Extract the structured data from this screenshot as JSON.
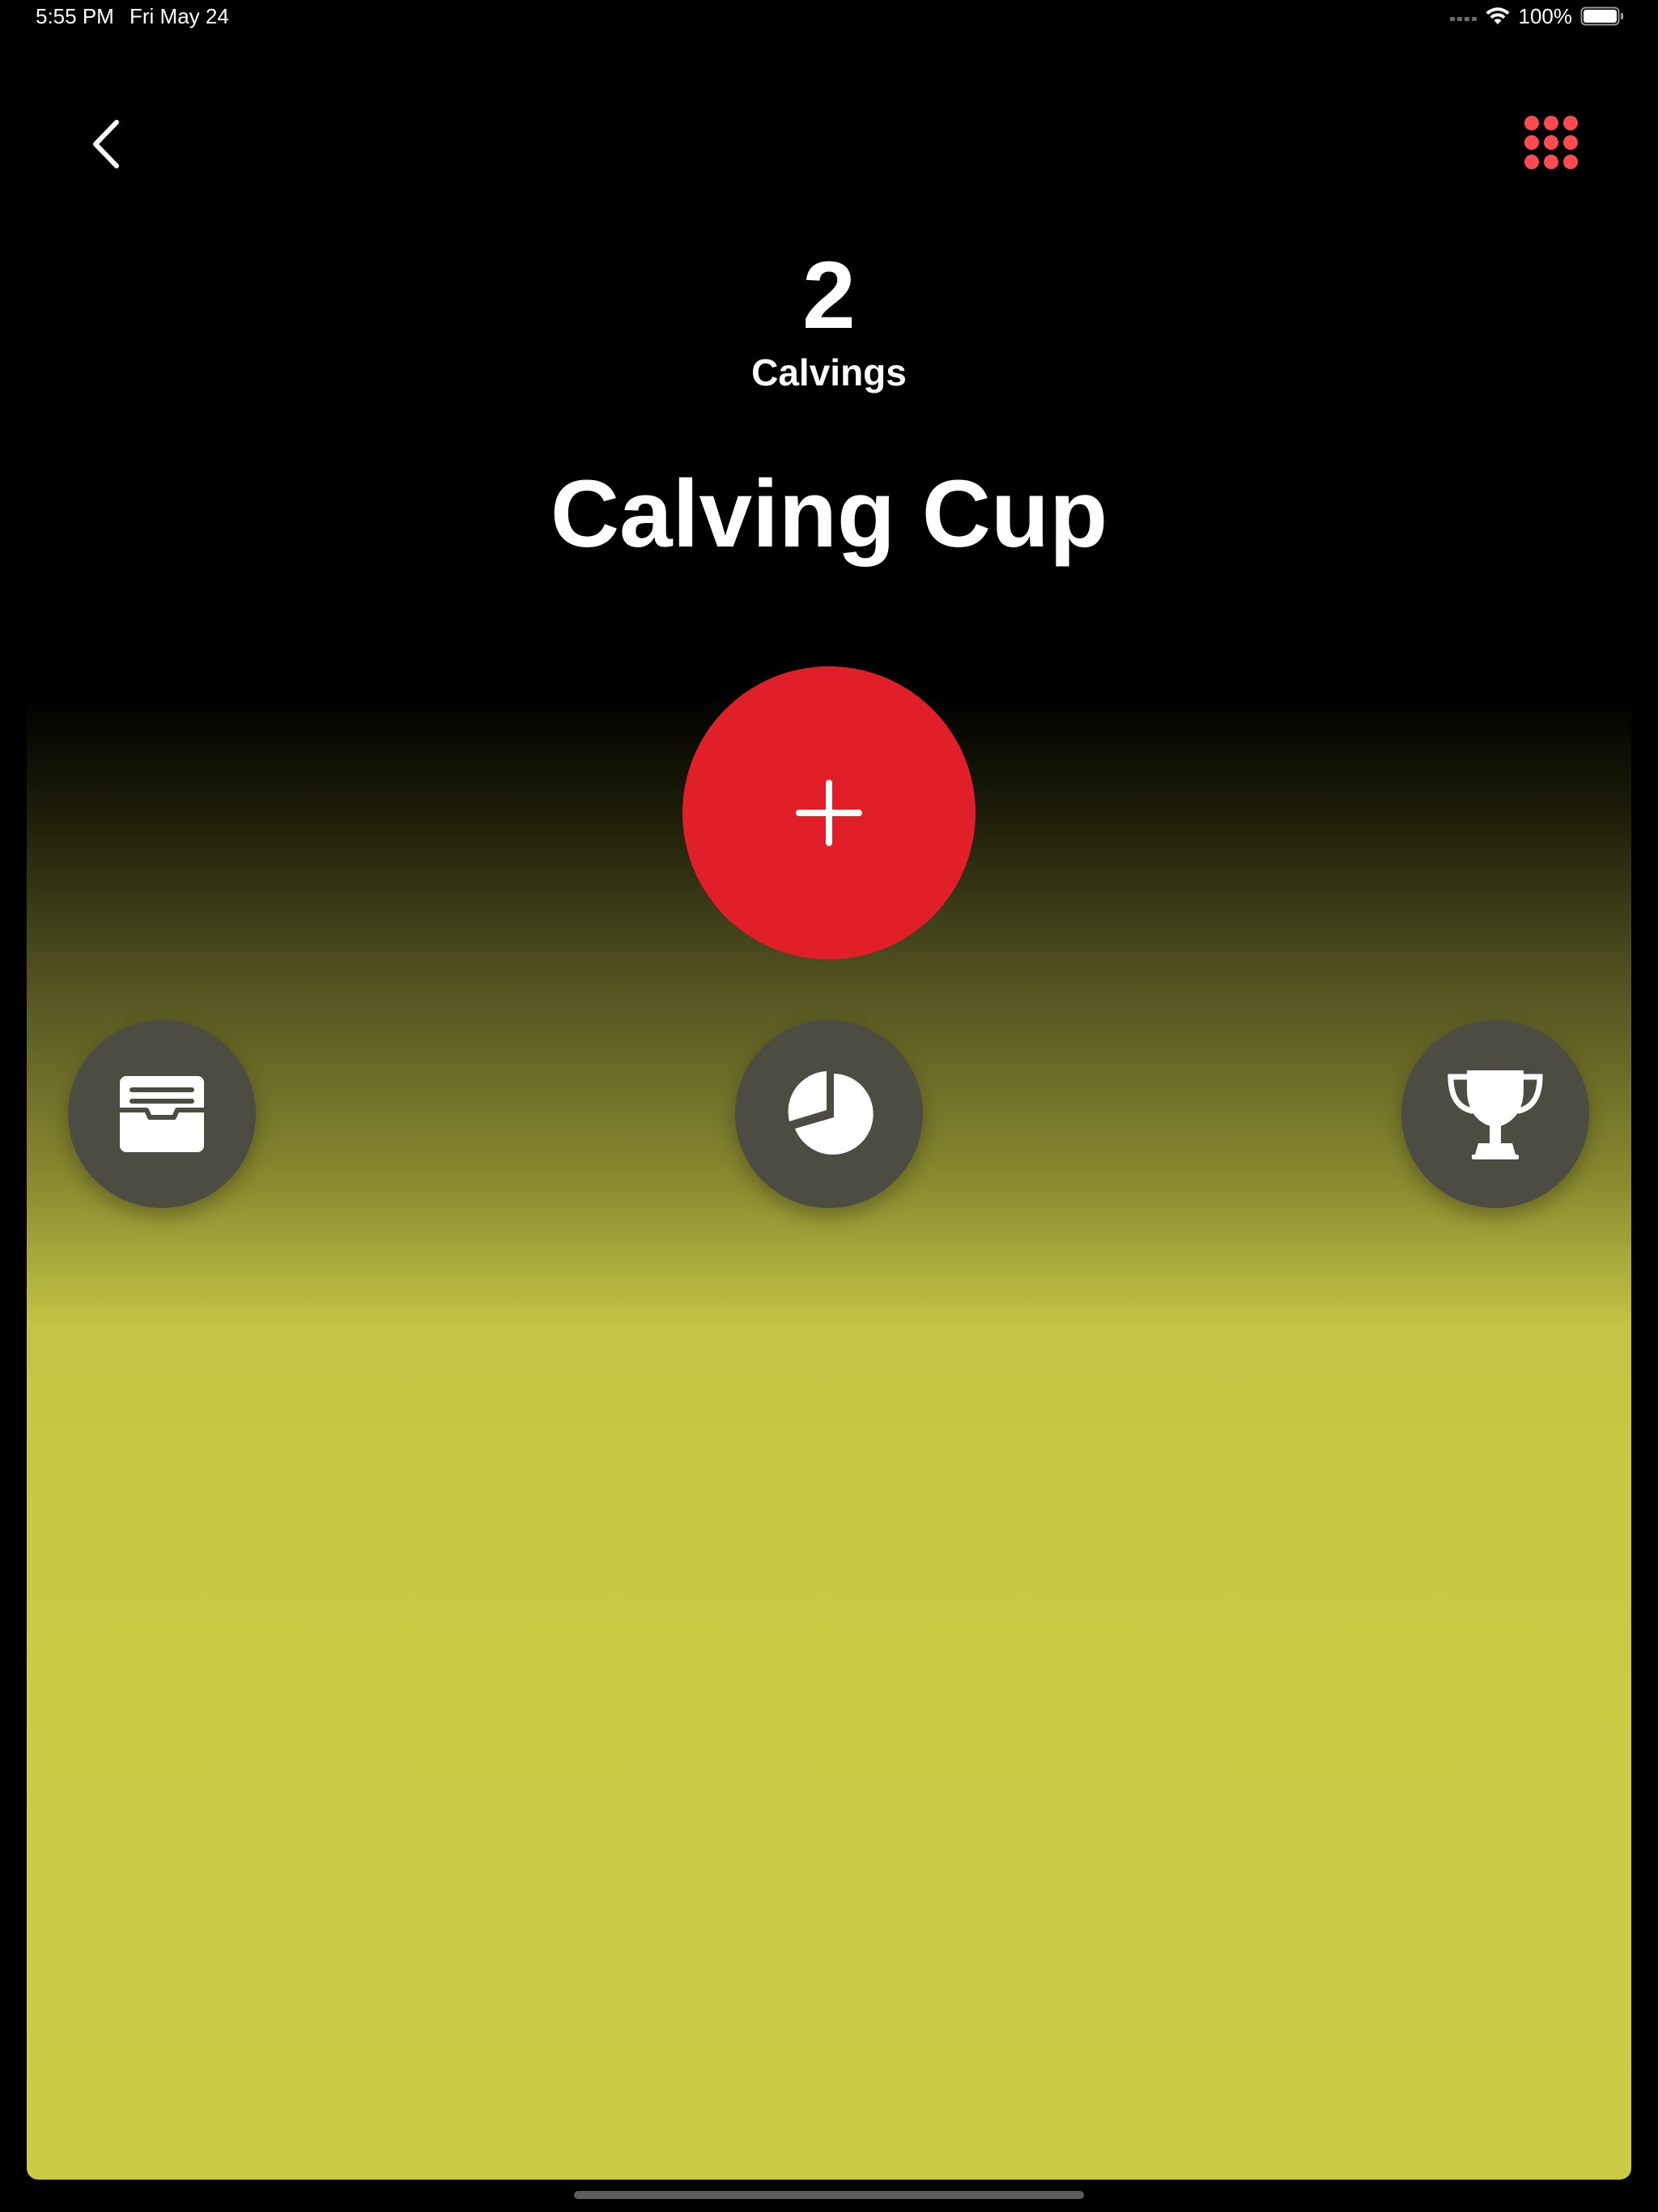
{
  "status_bar": {
    "time": "5:55 PM",
    "date": "Fri May 24",
    "battery": "100%"
  },
  "nav": {
    "back_icon": "chevron-left-icon",
    "menu_icon": "grid-dots-icon",
    "accent_color": "#ff4a4f"
  },
  "summary": {
    "count": "2",
    "count_label": "Calvings"
  },
  "title": "Calving Cup",
  "actions": {
    "add_icon": "plus-icon",
    "add_color": "#e01f28",
    "archive_icon": "archive-box-icon",
    "stats_icon": "pie-chart-icon",
    "trophy_icon": "trophy-icon",
    "button_color": "#4d4c42"
  },
  "theme": {
    "panel_color": "#cbcb46",
    "background": "#000000"
  }
}
